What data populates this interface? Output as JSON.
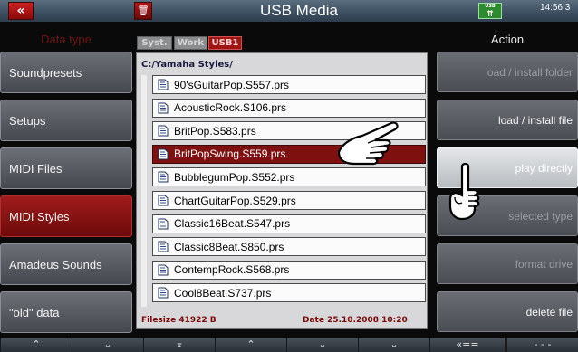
{
  "titlebar": {
    "back_icon": "«",
    "trash_icon": "🗑",
    "title": "USB Media",
    "usb_label": "USB",
    "usb_arrows": "⇈",
    "clock": "14:56:3"
  },
  "left_header": "Data type",
  "right_header": "Action",
  "data_types": [
    {
      "label": "Soundpresets",
      "active": false
    },
    {
      "label": "Setups",
      "active": false
    },
    {
      "label": "MIDI Files",
      "active": false
    },
    {
      "label": "MIDI Styles",
      "active": true
    },
    {
      "label": "Amadeus Sounds",
      "active": false
    },
    {
      "label": "\"old\" data",
      "active": false
    }
  ],
  "tabs": [
    {
      "label": "Syst.",
      "active": false
    },
    {
      "label": "Work",
      "active": false
    },
    {
      "label": "USB1",
      "active": true
    }
  ],
  "browser": {
    "path": "C:/Yamaha Styles/",
    "files": [
      "90'sGuitarPop.S557.prs",
      "AcousticRock.S106.prs",
      "BritPop.S583.prs",
      "BritPopSwing.S559.prs",
      "BubblegumPop.S552.prs",
      "ChartGuitarPop.S529.prs",
      "Classic16Beat.S547.prs",
      "Classic8Beat.S850.prs",
      "ContempRock.S568.prs",
      "Cool8Beat.S737.prs"
    ],
    "selected_index": 3,
    "filesize": "Filesize  41922 B",
    "date": "Date 25.10.2008    10:20"
  },
  "actions": [
    {
      "label": "load  /  install  folder",
      "state": "disabled"
    },
    {
      "label": "load  /  install  file",
      "state": "enabled"
    },
    {
      "label": "play  directly",
      "state": "highlight"
    },
    {
      "label": "selected  type",
      "state": "disabled"
    },
    {
      "label": "format  drive",
      "state": "disabled"
    },
    {
      "label": "delete  file",
      "state": "enabled"
    }
  ],
  "bottom_buttons": [
    {
      "label": "⌃",
      "name": "page-up-left"
    },
    {
      "label": "⌄",
      "name": "page-down-left"
    },
    {
      "label": "⌅",
      "name": "scroll-top"
    },
    {
      "label": "⌃",
      "name": "scroll-up"
    },
    {
      "label": "⌄",
      "name": "scroll-down"
    },
    {
      "label": "⌄",
      "name": "scroll-bottom"
    },
    {
      "label": "«==",
      "name": "back-dir"
    },
    {
      "label": "- - -",
      "name": "unused"
    }
  ],
  "colors": {
    "accent_red": "#a01414",
    "selected_row": "#7e1010"
  }
}
